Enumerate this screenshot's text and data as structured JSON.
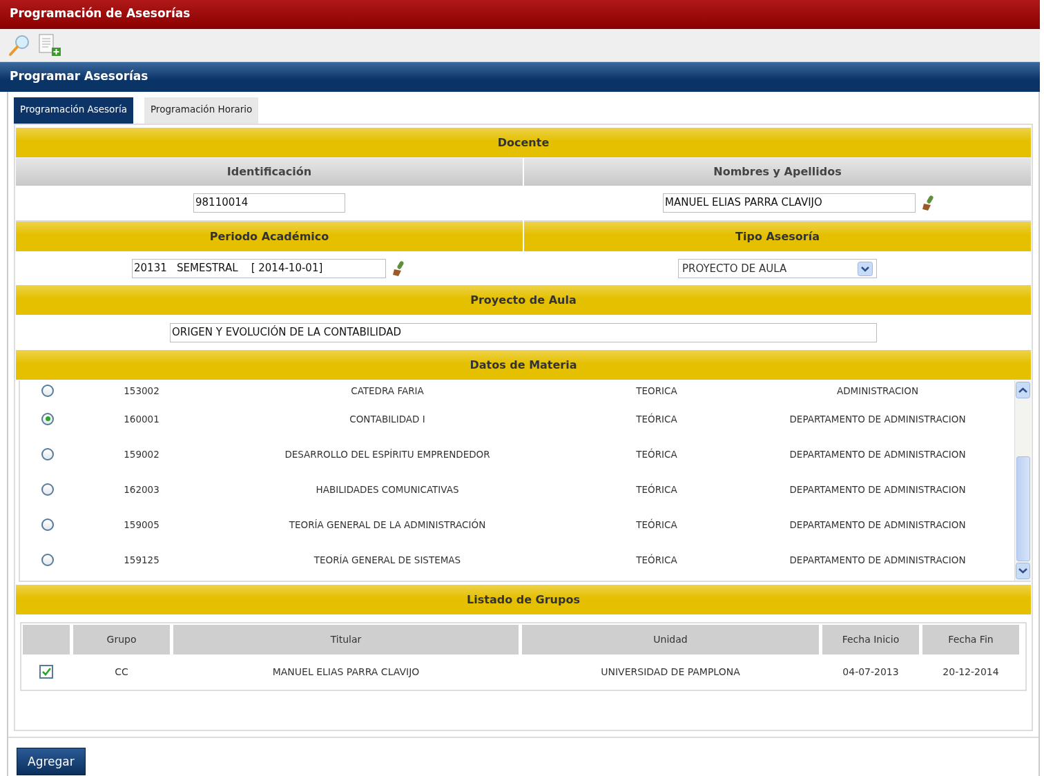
{
  "window": {
    "title": "Programación de Asesorías"
  },
  "section": {
    "title": "Programar Asesorías"
  },
  "tabs": [
    {
      "label": "Programación Asesoría",
      "selected": true
    },
    {
      "label": "Programación Horario",
      "selected": false
    }
  ],
  "docente": {
    "title": "Docente",
    "columns": [
      "Identificación",
      "Nombres y Apellidos"
    ],
    "identificacion": "98110014",
    "nombres": "MANUEL ELIAS PARRA CLAVIJO"
  },
  "periodo": {
    "title": "Periodo Académico",
    "value": "20131   SEMESTRAL    [ 2014-10-01]"
  },
  "tipo": {
    "title": "Tipo Asesoría",
    "value": "PROYECTO DE AULA"
  },
  "proyecto": {
    "title": "Proyecto de Aula",
    "value": "ORIGEN Y EVOLUCIÓN DE LA CONTABILIDAD"
  },
  "materias": {
    "title": "Datos de Materia",
    "rows": [
      {
        "selected": false,
        "code": "153002",
        "name": "CATEDRA FARIA",
        "type": "TEORICA",
        "department": "ADMINISTRACION"
      },
      {
        "selected": true,
        "code": "160001",
        "name": "CONTABILIDAD I",
        "type": "TEÓRICA",
        "department": "DEPARTAMENTO DE ADMINISTRACION"
      },
      {
        "selected": false,
        "code": "159002",
        "name": "DESARROLLO DEL ESPÍRITU EMPRENDEDOR",
        "type": "TEÓRICA",
        "department": "DEPARTAMENTO DE ADMINISTRACION"
      },
      {
        "selected": false,
        "code": "162003",
        "name": "HABILIDADES COMUNICATIVAS",
        "type": "TEÓRICA",
        "department": "DEPARTAMENTO DE ADMINISTRACION"
      },
      {
        "selected": false,
        "code": "159005",
        "name": "TEORÍA GENERAL DE LA ADMINISTRACIÓN",
        "type": "TEÓRICA",
        "department": "DEPARTAMENTO DE ADMINISTRACION"
      },
      {
        "selected": false,
        "code": "159125",
        "name": "TEORÍA GENERAL DE SISTEMAS",
        "type": "TEÓRICA",
        "department": "DEPARTAMENTO DE ADMINISTRACION"
      }
    ]
  },
  "grupos": {
    "title": "Listado de Grupos",
    "columns": [
      "Grupo",
      "Titular",
      "Unidad",
      "Fecha Inicio",
      "Fecha Fin"
    ],
    "rows": [
      {
        "checked": true,
        "cells": [
          "CC",
          "MANUEL ELIAS PARRA CLAVIJO",
          "UNIVERSIDAD DE PAMPLONA",
          "04-07-2013",
          "20-12-2014"
        ]
      }
    ]
  },
  "buttons": [
    "Agregar"
  ]
}
